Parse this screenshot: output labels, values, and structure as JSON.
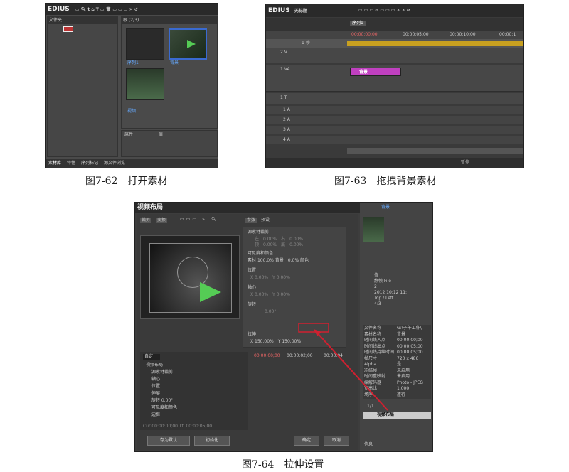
{
  "fig62": {
    "app": "EDIUS",
    "bin_tree_title": "文件夹",
    "bin_label": "根 (2/3)",
    "clips": [
      {
        "name": "序列1"
      },
      {
        "name": "背景"
      },
      {
        "name": "视频"
      }
    ],
    "prop_headers": [
      "属性",
      "值"
    ],
    "tabs": [
      "素材库",
      "特性",
      "序列标记",
      "源文件浏览"
    ],
    "caption": "图7-62　打开素材"
  },
  "fig63": {
    "app": "EDIUS",
    "project": "无标题",
    "seq_tab": "序列1",
    "timecodes": [
      "00:00:00;00",
      "00:00:05;00",
      "00:00:10;00",
      "00:00:1"
    ],
    "zoom": "1 秒",
    "tracks": [
      "2 V",
      "1 VA",
      "1 T",
      "1 A",
      "2 A",
      "3 A",
      "4 A"
    ],
    "clip_label": "背景",
    "status": "暂停",
    "caption": "图7-63　拖拽背景素材"
  },
  "fig64": {
    "title": "视频布局",
    "left_tabs": [
      "裁剪",
      "变换"
    ],
    "right_tabs": [
      "参数",
      "预设"
    ],
    "sections": [
      {
        "label": "源素材裁剪",
        "rows": [
          [
            "左",
            "0.00%",
            "右",
            "0.00%"
          ],
          [
            "顶",
            "0.00%",
            "底",
            "0.00%"
          ]
        ]
      },
      {
        "label": "可见度和颜色",
        "rows": [
          [
            "素材",
            "100.0%",
            "背景",
            "0.0%",
            "颜色"
          ]
        ]
      },
      {
        "label": "位置",
        "rows": [
          [
            "X",
            "0.00%",
            "Y",
            "0.00%"
          ]
        ]
      },
      {
        "label": "轴心",
        "rows": [
          [
            "X",
            "0.00%",
            "Y",
            "0.00%"
          ]
        ]
      },
      {
        "label": "旋转",
        "rows": [
          [
            "0.00°"
          ]
        ]
      },
      {
        "label": "拉伸",
        "rows": [
          [
            "X",
            "150.00%",
            "Y",
            "150.00%"
          ]
        ]
      }
    ],
    "dropdown": "自定",
    "tree": [
      "视频布局",
      "源素材裁剪",
      "轴心",
      "位置",
      "伸展",
      "旋转 0.00°",
      "可见度和颜色",
      "边框"
    ],
    "timecode": "Cur 00:00:00;00 Ttl 00:00:05;00",
    "tl_times": [
      "00:00:00;00",
      "00:00:02;00",
      "00:00:04"
    ],
    "buttons": [
      "存为默认",
      "初始化",
      "确定",
      "取消"
    ],
    "side_clip": "背景",
    "side_props": [
      "值",
      "静帧 File",
      "2",
      "2012 10:12 11:",
      "Top / Left",
      "4:3"
    ],
    "props_table": [
      [
        "文件名称",
        "G:\\子午工作\\"
      ],
      [
        "素材名称",
        "背景"
      ],
      [
        "时间线入点",
        "00:00:00;00"
      ],
      [
        "时间线出点",
        "00:00:05;00"
      ],
      [
        "时间线持续时间",
        "00:00:05;00"
      ],
      [
        "帧尺寸",
        "720 x 486"
      ],
      [
        "Alpha",
        "是"
      ],
      [
        "冻结帧",
        "未启用"
      ],
      [
        "时间重映射",
        "未启用"
      ],
      [
        "编解码器",
        "Photo - JPEG"
      ],
      [
        "宽高比",
        "1.000"
      ],
      [
        "场序",
        "逐行"
      ]
    ],
    "effects_tab": "1/1",
    "effect_item": "视频布局",
    "bottom_label": "信息",
    "caption": "图7-64　拉伸设置"
  },
  "colors": {
    "accent_clip": "#c040c0",
    "arrow": "#d02030",
    "selection": "#3a6ad0"
  }
}
